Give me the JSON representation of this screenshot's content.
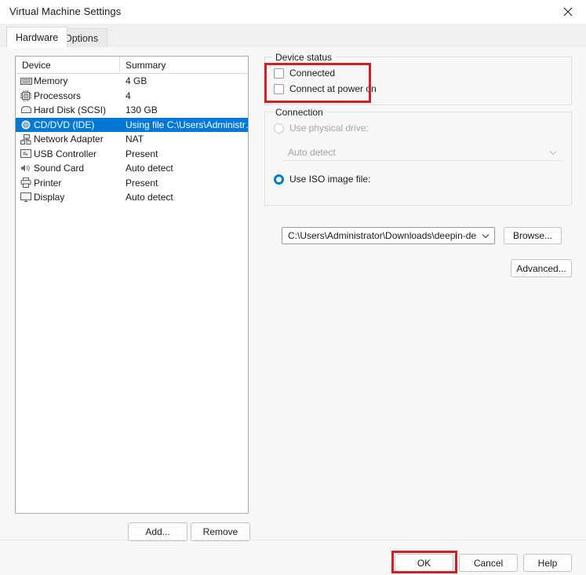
{
  "window": {
    "title": "Virtual Machine Settings",
    "close_icon": "close-icon"
  },
  "tabs": [
    {
      "label": "Hardware",
      "active": true
    },
    {
      "label": "Options",
      "active": false
    }
  ],
  "device_list": {
    "columns": {
      "device": "Device",
      "summary": "Summary"
    },
    "rows": [
      {
        "icon": "memory-icon",
        "label": "Memory",
        "summary": "4 GB",
        "selected": false
      },
      {
        "icon": "processor-icon",
        "label": "Processors",
        "summary": "4",
        "selected": false
      },
      {
        "icon": "hard-disk-icon",
        "label": "Hard Disk (SCSI)",
        "summary": "130 GB",
        "selected": false
      },
      {
        "icon": "cd-dvd-icon",
        "label": "CD/DVD (IDE)",
        "summary": "Using file C:\\Users\\Administr…",
        "selected": true
      },
      {
        "icon": "network-adapter-icon",
        "label": "Network Adapter",
        "summary": "NAT",
        "selected": false
      },
      {
        "icon": "usb-controller-icon",
        "label": "USB Controller",
        "summary": "Present",
        "selected": false
      },
      {
        "icon": "sound-card-icon",
        "label": "Sound Card",
        "summary": "Auto detect",
        "selected": false
      },
      {
        "icon": "printer-icon",
        "label": "Printer",
        "summary": "Present",
        "selected": false
      },
      {
        "icon": "display-icon",
        "label": "Display",
        "summary": "Auto detect",
        "selected": false
      }
    ],
    "add_label": "Add...",
    "remove_label": "Remove"
  },
  "device_status": {
    "title": "Device status",
    "connected": {
      "label": "Connected",
      "checked": false
    },
    "connect_at_power_on": {
      "label": "Connect at power on",
      "checked": false
    }
  },
  "connection": {
    "title": "Connection",
    "use_physical_drive": {
      "label": "Use physical drive:",
      "selected": false,
      "disabled": true
    },
    "physical_drive_value": "Auto detect",
    "use_iso_image": {
      "label": "Use ISO image file:",
      "selected": true,
      "disabled": false
    },
    "iso_path_value": "C:\\Users\\Administrator\\Downloads\\deepin-desktop-",
    "browse_label": "Browse...",
    "advanced_label": "Advanced..."
  },
  "dialog_buttons": {
    "ok": "OK",
    "cancel": "Cancel",
    "help": "Help"
  },
  "annotations": {
    "color": "#d21f1f",
    "device_status_box": "highlight-device-status",
    "ok_button_box": "highlight-ok-button"
  }
}
